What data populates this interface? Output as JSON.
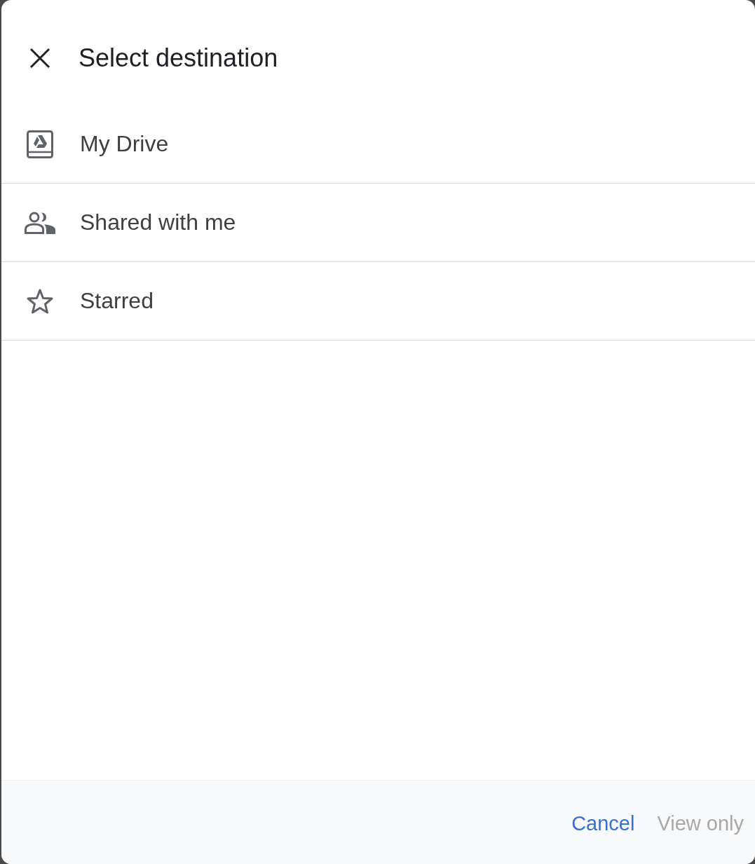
{
  "dialog": {
    "title": "Select destination"
  },
  "destinations": [
    {
      "label": "My Drive",
      "kind": "drive"
    },
    {
      "label": "Shared with me",
      "kind": "shared"
    },
    {
      "label": "Starred",
      "kind": "starred"
    }
  ],
  "footer": {
    "buttons": [
      {
        "label": "Cancel",
        "disabled": false
      },
      {
        "label": "View only",
        "disabled": true
      }
    ]
  }
}
